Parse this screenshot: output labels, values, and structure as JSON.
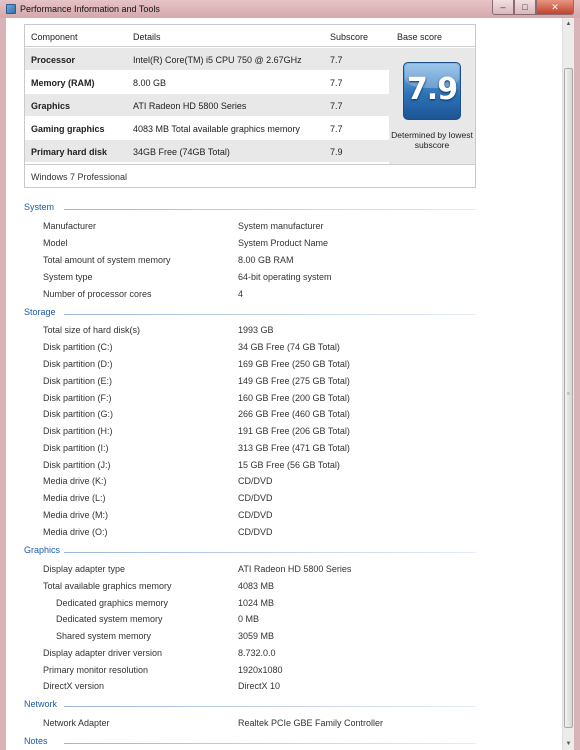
{
  "window": {
    "title": "Performance Information and Tools",
    "btn_min": "–",
    "btn_max": "□",
    "btn_close": "✕"
  },
  "score_table": {
    "headers": {
      "component": "Component",
      "details": "Details",
      "subscore": "Subscore",
      "base": "Base score"
    },
    "rows": [
      {
        "component": "Processor",
        "details": "Intel(R) Core(TM) i5 CPU 750 @ 2.67GHz",
        "subscore": "7.7"
      },
      {
        "component": "Memory (RAM)",
        "details": "8.00 GB",
        "subscore": "7.7"
      },
      {
        "component": "Graphics",
        "details": "ATI Radeon HD 5800 Series",
        "subscore": "7.7"
      },
      {
        "component": "Gaming graphics",
        "details": "4083 MB Total available graphics memory",
        "subscore": "7.7"
      },
      {
        "component": "Primary hard disk",
        "details": "34GB Free (74GB Total)",
        "subscore": "7.9"
      }
    ],
    "base_score": "7.9",
    "determined_by": "Determined by lowest subscore",
    "edition": "Windows 7 Professional"
  },
  "sections": {
    "system": {
      "title": "System",
      "items": [
        {
          "label": "Manufacturer",
          "value": "System manufacturer"
        },
        {
          "label": "Model",
          "value": "System Product Name"
        },
        {
          "label": "Total amount of system memory",
          "value": "8.00 GB RAM"
        },
        {
          "label": "System type",
          "value": "64-bit operating system"
        },
        {
          "label": "Number of processor cores",
          "value": "4"
        }
      ]
    },
    "storage": {
      "title": "Storage",
      "items": [
        {
          "label": "Total size of hard disk(s)",
          "value": "1993 GB"
        },
        {
          "label": "Disk partition (C:)",
          "value": "34 GB Free (74 GB Total)"
        },
        {
          "label": "Disk partition (D:)",
          "value": "169 GB Free (250 GB Total)"
        },
        {
          "label": "Disk partition (E:)",
          "value": "149 GB Free (275 GB Total)"
        },
        {
          "label": "Disk partition (F:)",
          "value": "160 GB Free (200 GB Total)"
        },
        {
          "label": "Disk partition (G:)",
          "value": "266 GB Free (460 GB Total)"
        },
        {
          "label": "Disk partition (H:)",
          "value": "191 GB Free (206 GB Total)"
        },
        {
          "label": "Disk partition (I:)",
          "value": "313 GB Free (471 GB Total)"
        },
        {
          "label": "Disk partition (J:)",
          "value": "15 GB Free (56 GB Total)"
        },
        {
          "label": "Media drive (K:)",
          "value": "CD/DVD"
        },
        {
          "label": "Media drive (L:)",
          "value": "CD/DVD"
        },
        {
          "label": "Media drive (M:)",
          "value": "CD/DVD"
        },
        {
          "label": "Media drive (O:)",
          "value": "CD/DVD"
        }
      ]
    },
    "graphics": {
      "title": "Graphics",
      "items": [
        {
          "label": "Display adapter type",
          "value": "ATI Radeon HD 5800 Series"
        },
        {
          "label": "Total available graphics memory",
          "value": "4083 MB"
        },
        {
          "label": "Dedicated graphics memory",
          "value": "1024 MB"
        },
        {
          "label": "Dedicated system memory",
          "value": "0 MB"
        },
        {
          "label": "Shared system memory",
          "value": "3059 MB"
        },
        {
          "label": "Display adapter driver version",
          "value": "8.732.0.0"
        },
        {
          "label": "Primary monitor resolution",
          "value": "1920x1080"
        },
        {
          "label": "DirectX version",
          "value": "DirectX 10"
        }
      ]
    },
    "network": {
      "title": "Network",
      "items": [
        {
          "label": "Network Adapter",
          "value": "Realtek PCIe GBE Family Controller"
        }
      ]
    },
    "notes": {
      "title": "Notes"
    }
  }
}
